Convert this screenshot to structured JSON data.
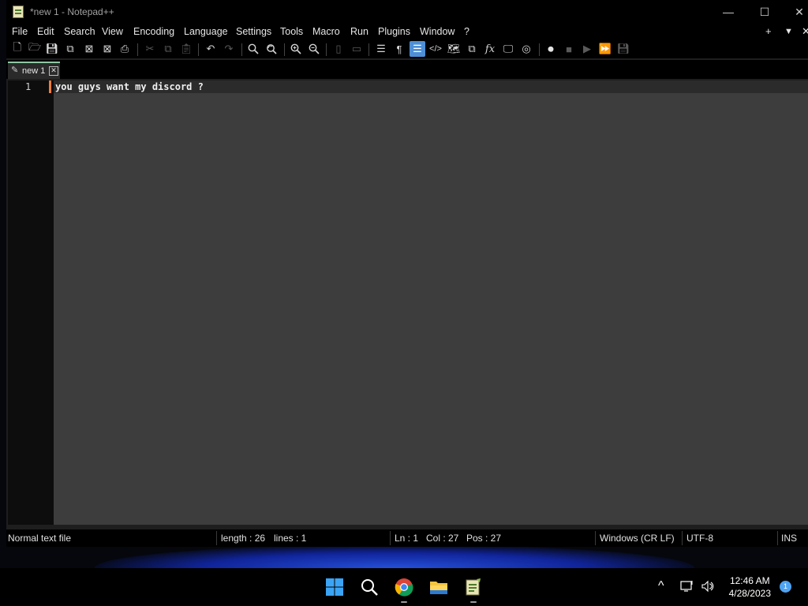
{
  "window": {
    "title": "*new 1 - Notepad++",
    "controls": {
      "minimize": "—",
      "maximize": "☐",
      "close": "✕"
    }
  },
  "menu": {
    "items": [
      "File",
      "Edit",
      "Search",
      "View",
      "Encoding",
      "Language",
      "Settings",
      "Tools",
      "Macro",
      "Run",
      "Plugins",
      "Window",
      "?"
    ],
    "extras": [
      "+",
      "▼",
      "✕"
    ]
  },
  "toolbar": {
    "icons": [
      "new-file-icon",
      "open-file-icon",
      "save-icon",
      "save-all-icon",
      "close-icon",
      "close-all-icon",
      "print-icon",
      "cut-icon",
      "copy-icon",
      "paste-icon",
      "undo-icon",
      "redo-icon",
      "find-icon",
      "replace-icon",
      "zoom-in-icon",
      "zoom-out-icon",
      "sync-vertical-icon",
      "sync-horizontal-icon",
      "word-wrap-icon",
      "show-all-characters-icon",
      "indent-guide-icon",
      "udl-icon",
      "document-map-icon",
      "document-list-icon",
      "function-list-icon",
      "folder-as-workspace-icon",
      "monitoring-icon",
      "record-macro-icon",
      "stop-recording-icon",
      "playback-macro-icon",
      "run-macro-multiple-icon",
      "save-macro-icon"
    ],
    "active_icon": "indent-guide-icon",
    "accent": "#4e8fd6"
  },
  "tabs": [
    {
      "label": "new 1",
      "close": "✕"
    }
  ],
  "editor": {
    "lines": [
      {
        "number": "1",
        "text": "you guys want my discord ?"
      }
    ],
    "caret_color": "#f07c3c"
  },
  "status": {
    "filetype": "Normal text file",
    "length": "length : 26",
    "lines": "lines : 1",
    "ln": "Ln : 1",
    "col": "Col : 27",
    "pos": "Pos : 27",
    "eol": "Windows (CR LF)",
    "encoding": "UTF-8",
    "mode": "INS"
  },
  "taskbar": {
    "apps": [
      "windows-start-icon",
      "search-icon",
      "chrome-icon",
      "file-explorer-icon",
      "notepadpp-icon"
    ],
    "tray": {
      "chevron": "^",
      "time": "12:46 AM",
      "date": "4/28/2023",
      "notifications": "1"
    }
  }
}
